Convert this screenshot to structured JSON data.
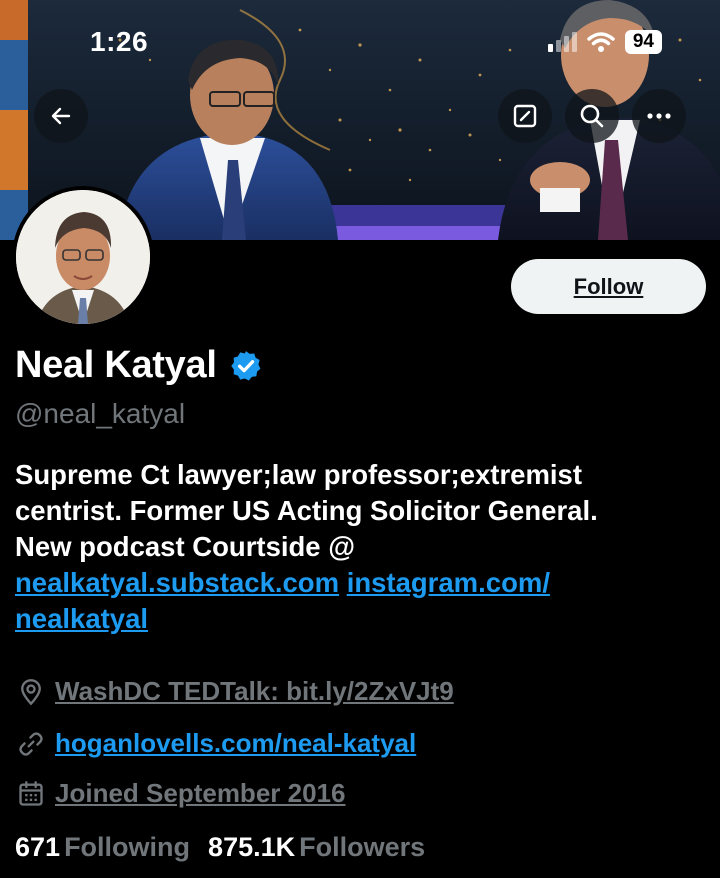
{
  "status_bar": {
    "time": "1:26",
    "battery": "94"
  },
  "profile": {
    "name": "Neal Katyal",
    "handle": "@neal_katyal",
    "follow_label": "Follow",
    "bio_line1": "Supreme Ct lawyer;law professor;extremist",
    "bio_line2": "centrist. Former US Acting Solicitor General.",
    "bio_line3": "New podcast Courtside @",
    "bio_link1": "nealkatyal.substack.com",
    "bio_link2a": "instagram.com/",
    "bio_link2b": "nealkatyal",
    "location": "WashDC TEDTalk: bit.ly/2ZxVJt9",
    "website": "hoganlovells.com/neal-katyal",
    "joined": "Joined September 2016",
    "following_count": "671",
    "following_label": "Following",
    "followers_count": "875.1K",
    "followers_label": "Followers"
  },
  "colors": {
    "accent": "#1d9bf0",
    "muted": "#71767b",
    "background": "#000000"
  },
  "icons": [
    "back-arrow-icon",
    "edit-icon",
    "search-icon",
    "more-icon",
    "verified-badge-icon",
    "location-pin-icon",
    "link-icon",
    "calendar-icon",
    "wifi-icon",
    "signal-icon"
  ]
}
